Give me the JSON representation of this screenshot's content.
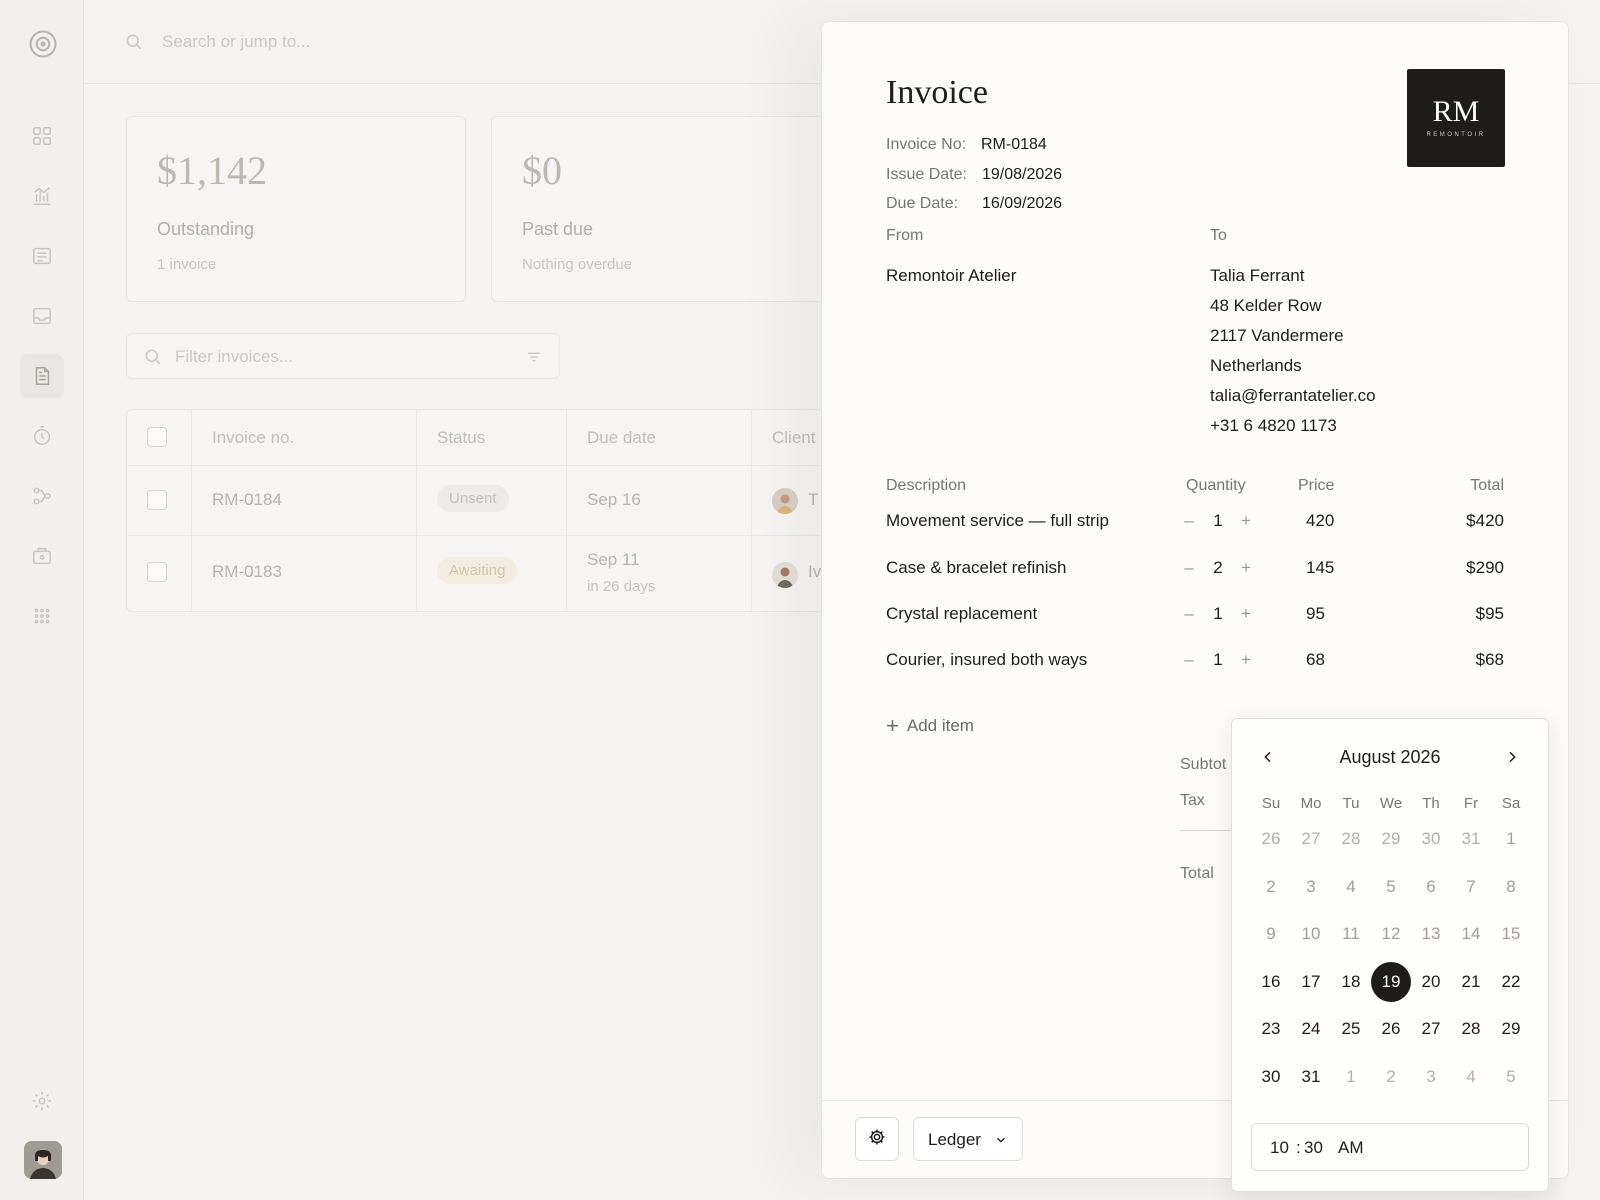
{
  "search": {
    "placeholder": "Search or jump to..."
  },
  "stats": [
    {
      "value": "$1,142",
      "label": "Outstanding",
      "sub": "1 invoice"
    },
    {
      "value": "$0",
      "label": "Past due",
      "sub": "Nothing overdue"
    }
  ],
  "filter": {
    "placeholder": "Filter invoices..."
  },
  "table": {
    "headers": [
      "Invoice no.",
      "Status",
      "Due date",
      "Client"
    ],
    "rows": [
      {
        "invoice": "RM-0184",
        "status": "Unsent",
        "due": "Sep 16",
        "due_sub": "",
        "client_initial": "T"
      },
      {
        "invoice": "RM-0183",
        "status": "Awaiting",
        "due": "Sep 11",
        "due_sub": "in 26 days",
        "client_initial": "Iv"
      }
    ]
  },
  "invoice": {
    "title": "Invoice",
    "meta": {
      "invoice_no_label": "Invoice No:",
      "invoice_no": "RM-0184",
      "issue_label": "Issue Date:",
      "issue_date": "19/08/2026",
      "due_label": "Due Date:",
      "due_date": "16/09/2026"
    },
    "logo": {
      "mono": "RM",
      "word": "REMONTOIR"
    },
    "from_label": "From",
    "to_label": "To",
    "from": {
      "name": "Remontoir Atelier"
    },
    "to": {
      "lines": [
        "Talia Ferrant",
        "48 Kelder Row",
        "2117 Vandermere",
        "Netherlands",
        "talia@ferrantatelier.co",
        "+31 6 4820 1173"
      ]
    },
    "columns": {
      "description": "Description",
      "quantity": "Quantity",
      "price": "Price",
      "total": "Total"
    },
    "items": [
      {
        "description": "Movement service — full strip",
        "qty": "1",
        "price": "420",
        "total": "$420"
      },
      {
        "description": "Case & bracelet refinish",
        "qty": "2",
        "price": "145",
        "total": "$290"
      },
      {
        "description": "Crystal replacement",
        "qty": "1",
        "price": "95",
        "total": "$95"
      },
      {
        "description": "Courier, insured both ways",
        "qty": "1",
        "price": "68",
        "total": "$68"
      }
    ],
    "qty_minus": "–",
    "qty_plus": "+",
    "add_item_plus": "+",
    "add_item": "Add item",
    "summary": {
      "subtotal": "Subtot",
      "tax": "Tax",
      "total": "Total"
    },
    "footer": {
      "ledger": "Ledger"
    }
  },
  "datepicker": {
    "month": "August 2026",
    "weekdays": [
      "Su",
      "Mo",
      "Tu",
      "We",
      "Th",
      "Fr",
      "Sa"
    ],
    "weeks": [
      [
        "26",
        "27",
        "28",
        "29",
        "30",
        "31",
        "1"
      ],
      [
        "2",
        "3",
        "4",
        "5",
        "6",
        "7",
        "8"
      ],
      [
        "9",
        "10",
        "11",
        "12",
        "13",
        "14",
        "15"
      ],
      [
        "16",
        "17",
        "18",
        "19",
        "20",
        "21",
        "22"
      ],
      [
        "23",
        "24",
        "25",
        "26",
        "27",
        "28",
        "29"
      ],
      [
        "30",
        "31",
        "1",
        "2",
        "3",
        "4",
        "5"
      ]
    ],
    "selected_day": "19",
    "time": {
      "hour": "10",
      "sep": ":",
      "minute": "30",
      "period": "AM"
    }
  },
  "colors": {
    "accent": "#1f1d1b",
    "background": "#f4f3f1",
    "panel": "#fdfcfb"
  }
}
